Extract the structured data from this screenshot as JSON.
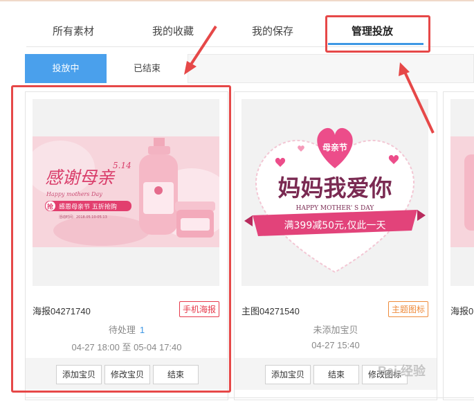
{
  "main_tabs": [
    {
      "label": "所有素材"
    },
    {
      "label": "我的收藏"
    },
    {
      "label": "我的保存"
    },
    {
      "label": "管理投放",
      "active": true
    }
  ],
  "sub_tabs": [
    {
      "label": "投放中",
      "active": true
    },
    {
      "label": "已结束"
    }
  ],
  "cards": [
    {
      "image": {
        "headline": "感谢母亲",
        "date_mark": "5.14",
        "subtitle": "Happy mothers Day",
        "banner": "感恩母亲节 五折抢购",
        "badge": "抢",
        "period": "活动时间：2018.05.10-05.13"
      },
      "title": "海报04271740",
      "tag": "手机海报",
      "status_label": "待处理",
      "status_count": "1",
      "date_range": "04-27 18:00 至 05-04 17:40",
      "buttons": [
        "添加宝贝",
        "修改宝贝",
        "结束"
      ]
    },
    {
      "image": {
        "heart_label": "母亲节",
        "headline": "妈妈我爱你",
        "subtitle": "HAPPY MOTHER' S DAY",
        "ribbon": "满399减50元,仅此一天"
      },
      "title": "主图04271540",
      "tag": "主题图标",
      "status_label": "未添加宝贝",
      "date_range": "04-27 15:40",
      "buttons": [
        "添加宝贝",
        "结束",
        "修改图标"
      ]
    },
    {
      "title": "海报0"
    }
  ],
  "watermark": "Bai 经验",
  "colors": {
    "accent_blue": "#4aa0ec",
    "highlight_red": "#e64848",
    "tag_red": "#e6394b",
    "tag_orange": "#ee8a3a"
  }
}
